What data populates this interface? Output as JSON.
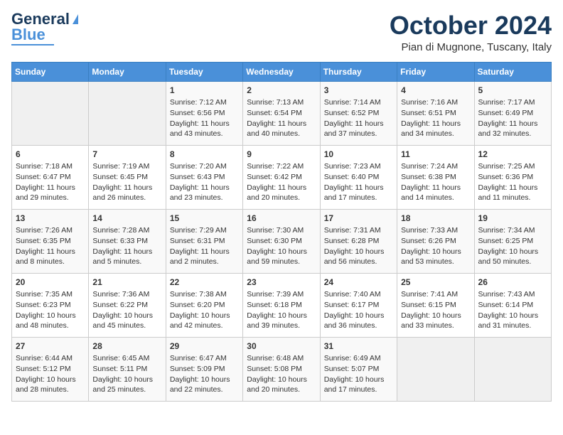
{
  "logo": {
    "line1": "General",
    "line2": "Blue"
  },
  "title": "October 2024",
  "location": "Pian di Mugnone, Tuscany, Italy",
  "headers": [
    "Sunday",
    "Monday",
    "Tuesday",
    "Wednesday",
    "Thursday",
    "Friday",
    "Saturday"
  ],
  "weeks": [
    [
      {
        "day": "",
        "info": ""
      },
      {
        "day": "",
        "info": ""
      },
      {
        "day": "1",
        "info": "Sunrise: 7:12 AM\nSunset: 6:56 PM\nDaylight: 11 hours and 43 minutes."
      },
      {
        "day": "2",
        "info": "Sunrise: 7:13 AM\nSunset: 6:54 PM\nDaylight: 11 hours and 40 minutes."
      },
      {
        "day": "3",
        "info": "Sunrise: 7:14 AM\nSunset: 6:52 PM\nDaylight: 11 hours and 37 minutes."
      },
      {
        "day": "4",
        "info": "Sunrise: 7:16 AM\nSunset: 6:51 PM\nDaylight: 11 hours and 34 minutes."
      },
      {
        "day": "5",
        "info": "Sunrise: 7:17 AM\nSunset: 6:49 PM\nDaylight: 11 hours and 32 minutes."
      }
    ],
    [
      {
        "day": "6",
        "info": "Sunrise: 7:18 AM\nSunset: 6:47 PM\nDaylight: 11 hours and 29 minutes."
      },
      {
        "day": "7",
        "info": "Sunrise: 7:19 AM\nSunset: 6:45 PM\nDaylight: 11 hours and 26 minutes."
      },
      {
        "day": "8",
        "info": "Sunrise: 7:20 AM\nSunset: 6:43 PM\nDaylight: 11 hours and 23 minutes."
      },
      {
        "day": "9",
        "info": "Sunrise: 7:22 AM\nSunset: 6:42 PM\nDaylight: 11 hours and 20 minutes."
      },
      {
        "day": "10",
        "info": "Sunrise: 7:23 AM\nSunset: 6:40 PM\nDaylight: 11 hours and 17 minutes."
      },
      {
        "day": "11",
        "info": "Sunrise: 7:24 AM\nSunset: 6:38 PM\nDaylight: 11 hours and 14 minutes."
      },
      {
        "day": "12",
        "info": "Sunrise: 7:25 AM\nSunset: 6:36 PM\nDaylight: 11 hours and 11 minutes."
      }
    ],
    [
      {
        "day": "13",
        "info": "Sunrise: 7:26 AM\nSunset: 6:35 PM\nDaylight: 11 hours and 8 minutes."
      },
      {
        "day": "14",
        "info": "Sunrise: 7:28 AM\nSunset: 6:33 PM\nDaylight: 11 hours and 5 minutes."
      },
      {
        "day": "15",
        "info": "Sunrise: 7:29 AM\nSunset: 6:31 PM\nDaylight: 11 hours and 2 minutes."
      },
      {
        "day": "16",
        "info": "Sunrise: 7:30 AM\nSunset: 6:30 PM\nDaylight: 10 hours and 59 minutes."
      },
      {
        "day": "17",
        "info": "Sunrise: 7:31 AM\nSunset: 6:28 PM\nDaylight: 10 hours and 56 minutes."
      },
      {
        "day": "18",
        "info": "Sunrise: 7:33 AM\nSunset: 6:26 PM\nDaylight: 10 hours and 53 minutes."
      },
      {
        "day": "19",
        "info": "Sunrise: 7:34 AM\nSunset: 6:25 PM\nDaylight: 10 hours and 50 minutes."
      }
    ],
    [
      {
        "day": "20",
        "info": "Sunrise: 7:35 AM\nSunset: 6:23 PM\nDaylight: 10 hours and 48 minutes."
      },
      {
        "day": "21",
        "info": "Sunrise: 7:36 AM\nSunset: 6:22 PM\nDaylight: 10 hours and 45 minutes."
      },
      {
        "day": "22",
        "info": "Sunrise: 7:38 AM\nSunset: 6:20 PM\nDaylight: 10 hours and 42 minutes."
      },
      {
        "day": "23",
        "info": "Sunrise: 7:39 AM\nSunset: 6:18 PM\nDaylight: 10 hours and 39 minutes."
      },
      {
        "day": "24",
        "info": "Sunrise: 7:40 AM\nSunset: 6:17 PM\nDaylight: 10 hours and 36 minutes."
      },
      {
        "day": "25",
        "info": "Sunrise: 7:41 AM\nSunset: 6:15 PM\nDaylight: 10 hours and 33 minutes."
      },
      {
        "day": "26",
        "info": "Sunrise: 7:43 AM\nSunset: 6:14 PM\nDaylight: 10 hours and 31 minutes."
      }
    ],
    [
      {
        "day": "27",
        "info": "Sunrise: 6:44 AM\nSunset: 5:12 PM\nDaylight: 10 hours and 28 minutes."
      },
      {
        "day": "28",
        "info": "Sunrise: 6:45 AM\nSunset: 5:11 PM\nDaylight: 10 hours and 25 minutes."
      },
      {
        "day": "29",
        "info": "Sunrise: 6:47 AM\nSunset: 5:09 PM\nDaylight: 10 hours and 22 minutes."
      },
      {
        "day": "30",
        "info": "Sunrise: 6:48 AM\nSunset: 5:08 PM\nDaylight: 10 hours and 20 minutes."
      },
      {
        "day": "31",
        "info": "Sunrise: 6:49 AM\nSunset: 5:07 PM\nDaylight: 10 hours and 17 minutes."
      },
      {
        "day": "",
        "info": ""
      },
      {
        "day": "",
        "info": ""
      }
    ]
  ]
}
